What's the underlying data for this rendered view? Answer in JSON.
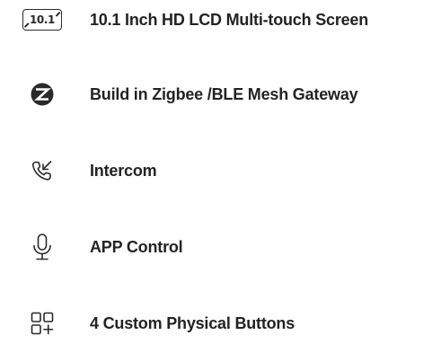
{
  "features": [
    {
      "icon": "screen-size-icon",
      "icon_text": "10.1",
      "label": "10.1 Inch HD LCD Multi-touch Screen"
    },
    {
      "icon": "zigbee-logo-icon",
      "label": "Build in Zigbee /BLE Mesh Gateway"
    },
    {
      "icon": "intercom-phone-icon",
      "label": "Intercom"
    },
    {
      "icon": "microphone-icon",
      "label": "APP Control"
    },
    {
      "icon": "grid-plus-icon",
      "label": "4 Custom Physical Buttons"
    }
  ],
  "colors": {
    "text": "#232323",
    "icon": "#2a2a2a",
    "background": "#ffffff"
  }
}
